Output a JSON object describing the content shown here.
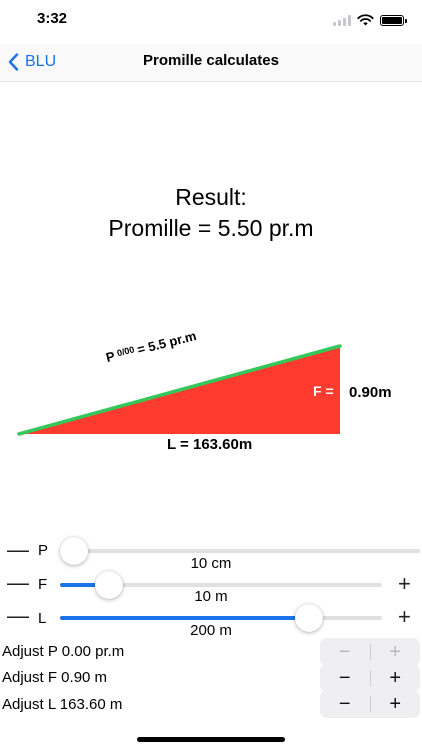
{
  "status_bar": {
    "time": "3:32",
    "icons": [
      "signal-icon",
      "wifi-icon",
      "battery-icon"
    ]
  },
  "navbar": {
    "back_label": "BLU",
    "title": "Promille calculates"
  },
  "result": {
    "label": "Result:",
    "value": "Promille = 5.50 pr.m"
  },
  "diagram": {
    "p_prefix": "P",
    "p_sub": "0/00",
    "p_value": "= 5.5 pr.m",
    "f_label": "F =",
    "f_value": "0.90m",
    "l_label": "L = 163.60m",
    "colors": {
      "triangle_fill": "#ff3b30",
      "slope_line": "#34c759"
    }
  },
  "sliders": {
    "p": {
      "letter": "P",
      "value_label": "10 cm",
      "fraction": 0.0,
      "has_plus": false
    },
    "f": {
      "letter": "F",
      "value_label": "10 m",
      "fraction": 0.12,
      "has_plus": true
    },
    "l": {
      "letter": "L",
      "value_label": "200 m",
      "fraction": 0.8,
      "has_plus": true
    },
    "minus": "—",
    "plus": "+"
  },
  "adjust": [
    {
      "label": "Adjust P  0.00  pr.m",
      "minus": "−",
      "plus": "+",
      "disabled": true
    },
    {
      "label": "Adjust F  0.90 m",
      "minus": "−",
      "plus": "+",
      "disabled": false
    },
    {
      "label": "Adjust L  163.60 m",
      "minus": "−",
      "plus": "+",
      "disabled": false
    }
  ],
  "accent_color": "#1a73e8"
}
